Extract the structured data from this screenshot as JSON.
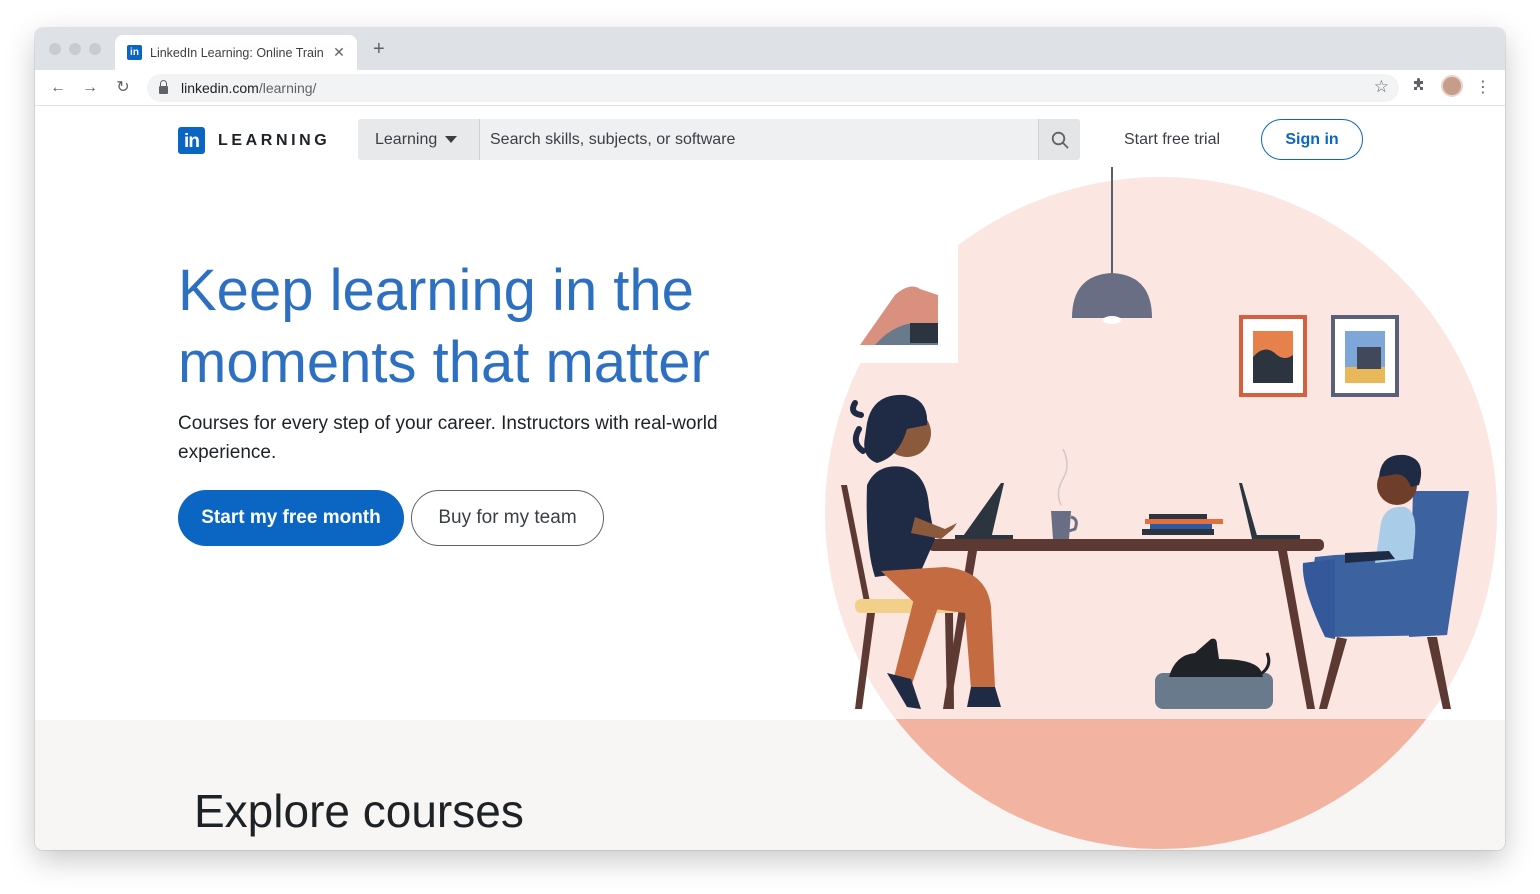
{
  "browser": {
    "tab_title": "LinkedIn Learning: Online Train",
    "tab_favicon_text": "in",
    "url_host": "linkedin.com",
    "url_path": "/learning/"
  },
  "header": {
    "logo_mark": "in",
    "logo_text": "LEARNING",
    "search_category": "Learning",
    "search_placeholder": "Search skills, subjects, or software",
    "start_trial": "Start free trial",
    "sign_in": "Sign in"
  },
  "hero": {
    "title": "Keep learning in the moments that matter",
    "subtitle": "Courses for every step of your career. Instructors with real-world experience.",
    "primary_cta": "Start my free month",
    "secondary_cta": "Buy for my team"
  },
  "explore": {
    "title": "Explore courses"
  },
  "colors": {
    "brand_blue": "#0a66c2",
    "headline_blue": "#2d70c2",
    "illustration_bg": "#fce6e2",
    "floor": "#f2b3a1"
  }
}
